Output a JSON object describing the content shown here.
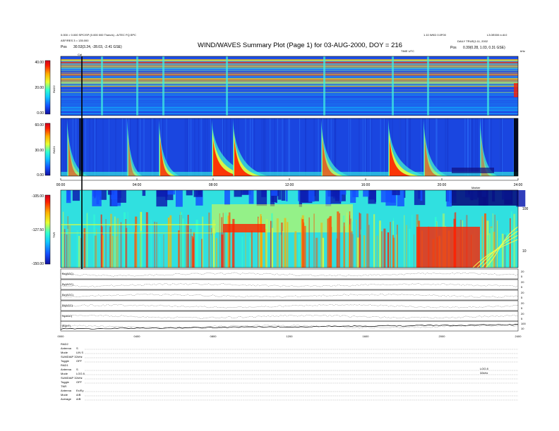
{
  "header": {
    "title": "WIND/WAVES Summary Plot (Page 1) for 03-AUG-2000, DOY = 216",
    "left_line1": "0.000 > 0.000 SPC/SP (0.000 000 T/sec/s) - A/TEC FQ.SPC",
    "left_line2": "ASF/RES 3 = 135.000",
    "left_line3_label": "Pos",
    "left_line3_value": "30.53(3.24, -28.03, -2.41 GSE)",
    "right_line1": "1.10 WKD 0.0F00",
    "right_line1b": "L3.0E000 n=8.0",
    "right_line2": "DAILY TRUE(1:11, 2002",
    "right_line3_label": "Pos",
    "right_line3_value": "0.39(0.28, 1.03, 0.31 GSE)",
    "center_small": "TIME UTC",
    "right_corner": "kHz",
    "cal_marker": "Cal"
  },
  "panels": [
    {
      "id": "rad2",
      "label": "RAD2",
      "ticks": [
        "40.00",
        "20.00",
        "0.00"
      ]
    },
    {
      "id": "rad1",
      "label": "RAD1",
      "ticks": [
        "60.00",
        "30.00",
        "0.00"
      ]
    },
    {
      "id": "tnr",
      "label": "TNR",
      "ticks": [
        "-105.00",
        "-127.50",
        "-150.00"
      ],
      "right_ticks": [
        "100",
        "10"
      ]
    }
  ],
  "time_axis": [
    "00:00",
    "04:00",
    "08:00",
    "12:00",
    "16:00",
    "20:00",
    "24:00"
  ],
  "tnr_marker": "Marker",
  "line_panels": [
    {
      "id": "bx",
      "label": "Bx(AGC)",
      "right_ticks": [
        "20",
        "5"
      ]
    },
    {
      "id": "by",
      "label": "By(AGC)",
      "right_ticks": [
        "20",
        "5"
      ]
    },
    {
      "id": "bz",
      "label": "Bz(AGC)",
      "right_ticks": [
        "20",
        "5"
      ]
    },
    {
      "id": "bt",
      "label": "Bt(AGC)",
      "right_ticks": [
        "20",
        "5"
      ]
    },
    {
      "id": "np",
      "label": "N(AGC)",
      "right_ticks": [
        "20",
        "5"
      ]
    },
    {
      "id": "bb",
      "label": "|B|(nT)",
      "right_ticks": [
        "100",
        "10"
      ]
    }
  ],
  "line_axis": [
    "0000",
    "0400",
    "0800",
    "1200",
    "1600",
    "2000",
    "2400"
  ],
  "footer": {
    "rad2_title": "RAD2",
    "rad2_rows": [
      {
        "k": "Antenna",
        "v": "S"
      },
      {
        "k": "Mode",
        "v": "LIN S"
      },
      {
        "k": "SUMDIAP 32kHz",
        "v": ""
      },
      {
        "k": "Toggle",
        "v": "OFF"
      }
    ],
    "rad1_title": "RAD1",
    "rad1_rows": [
      {
        "k": "Antenna",
        "v": "S"
      },
      {
        "k": "Mode",
        "v": "LOG 8"
      },
      {
        "k": "SUMDIAP 32kHz",
        "v": ""
      },
      {
        "k": "Toggle",
        "v": "OFF"
      }
    ],
    "tnr_title": "TNR",
    "tnr_rows": [
      {
        "k": "Antenna",
        "v": "Ex/Ey"
      },
      {
        "k": "Mode",
        "v": "A/B"
      },
      {
        "k": "Average",
        "v": "A/B"
      }
    ],
    "right_notes": [
      "LOG 8",
      "32kHz"
    ]
  },
  "chart_data": [
    {
      "type": "heatmap",
      "title": "RAD2",
      "xlabel": "",
      "ylabel": "RAD2",
      "x": [
        "00:00",
        "04:00",
        "08:00",
        "12:00",
        "16:00",
        "20:00",
        "24:00"
      ],
      "zlim": [
        0,
        40
      ],
      "colorbar_ticks": [
        0,
        20,
        40
      ]
    },
    {
      "type": "heatmap",
      "title": "RAD1",
      "xlabel": "",
      "ylabel": "RAD1",
      "x": [
        "00:00",
        "04:00",
        "08:00",
        "12:00",
        "16:00",
        "20:00",
        "24:00"
      ],
      "zlim": [
        0,
        60
      ],
      "colorbar_ticks": [
        0,
        30,
        60
      ]
    },
    {
      "type": "heatmap",
      "title": "TNR",
      "xlabel": "",
      "ylabel": "TNR",
      "x": [
        "00:00",
        "04:00",
        "08:00",
        "12:00",
        "16:00",
        "20:00",
        "24:00"
      ],
      "zlim": [
        -150,
        -105
      ],
      "colorbar_ticks": [
        -150,
        -127.5,
        -105
      ],
      "y_scale": "log",
      "y_ticks": [
        10,
        100
      ]
    },
    {
      "type": "line",
      "title": "",
      "series": [
        {
          "name": "Bx(AGC)"
        },
        {
          "name": "By(AGC)"
        },
        {
          "name": "Bz(AGC)"
        },
        {
          "name": "Bt(AGC)"
        },
        {
          "name": "N(AGC)"
        },
        {
          "name": "|B|(nT)"
        }
      ],
      "x": [
        "0000",
        "0400",
        "0800",
        "1200",
        "1600",
        "2000",
        "2400"
      ]
    }
  ]
}
